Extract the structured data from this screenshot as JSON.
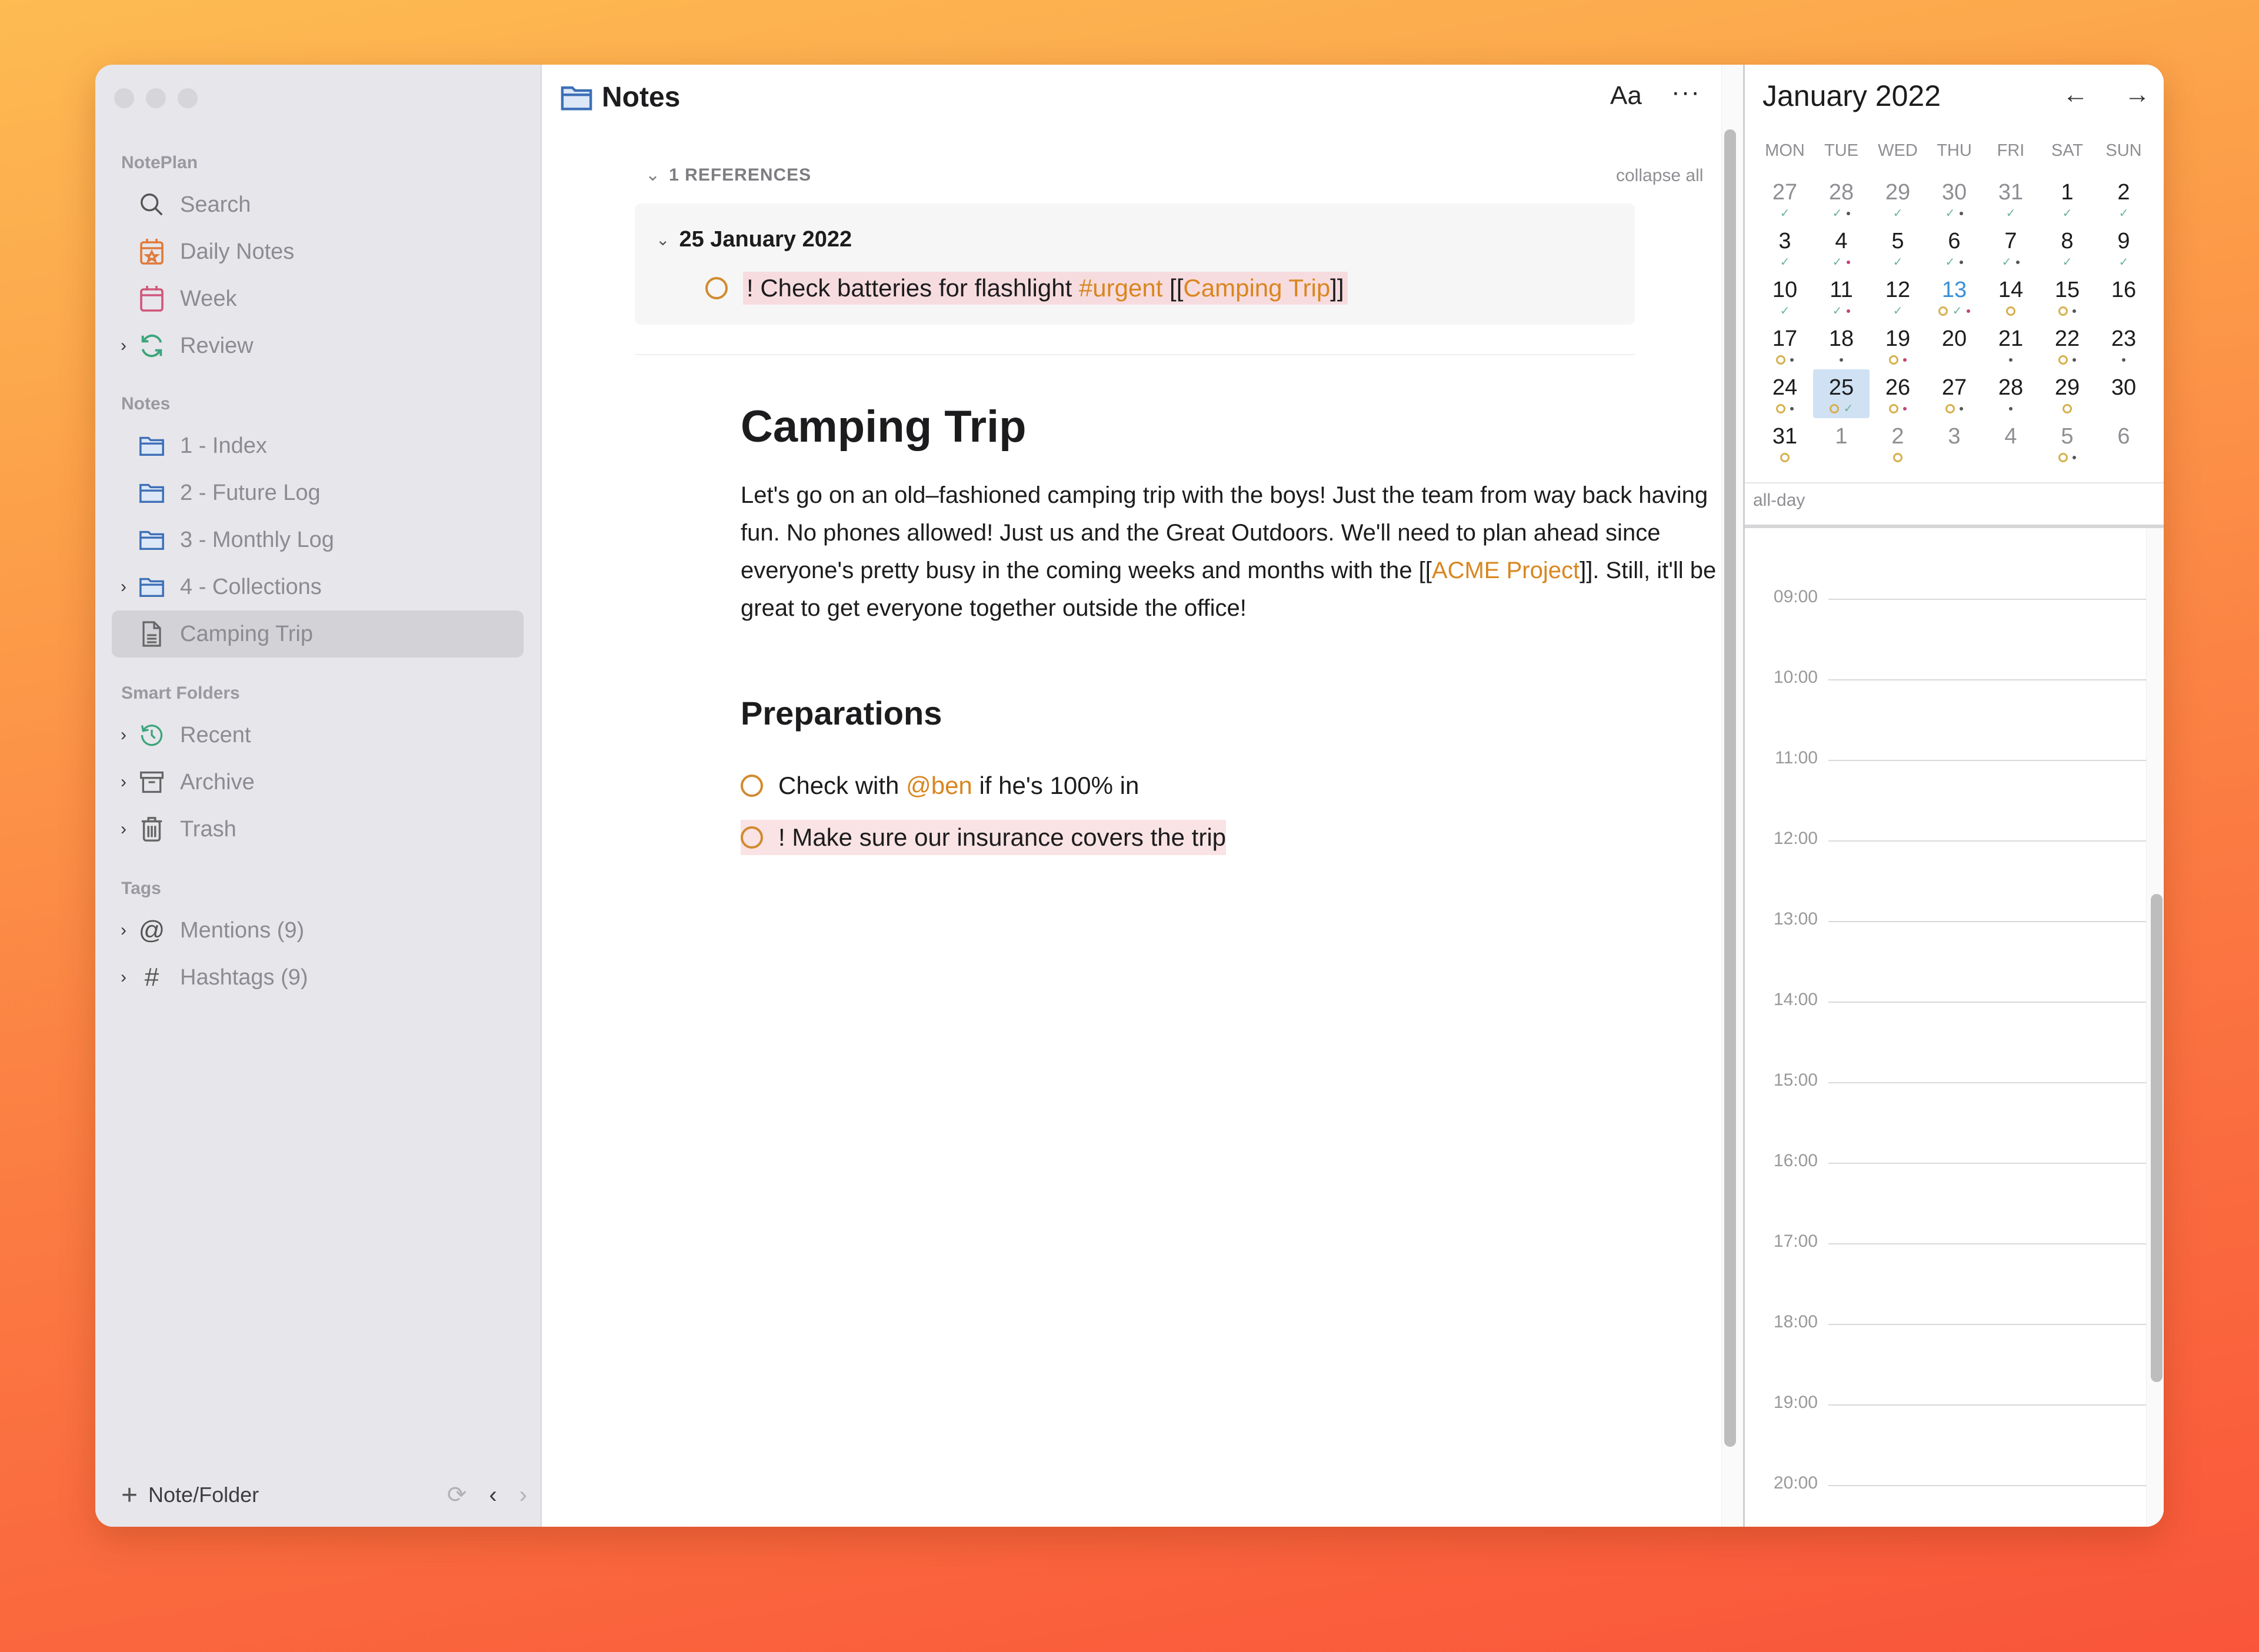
{
  "window": {
    "title": "Notes"
  },
  "sidebar": {
    "sections": [
      {
        "label": "NotePlan"
      },
      {
        "label": "Notes"
      },
      {
        "label": "Smart Folders"
      },
      {
        "label": "Tags"
      }
    ],
    "items": [
      {
        "label": "Search",
        "icon": "search-icon",
        "chevron": false
      },
      {
        "label": "Daily Notes",
        "icon": "daily-calendar-icon",
        "chevron": false
      },
      {
        "label": "Week",
        "icon": "week-calendar-icon",
        "chevron": false
      },
      {
        "label": "Review",
        "icon": "refresh-icon",
        "chevron": true
      },
      {
        "label": "1 - Index",
        "icon": "folder-icon",
        "chevron": false
      },
      {
        "label": "2 - Future Log",
        "icon": "folder-icon",
        "chevron": false
      },
      {
        "label": "3 - Monthly Log",
        "icon": "folder-icon",
        "chevron": false
      },
      {
        "label": "4 - Collections",
        "icon": "folder-icon",
        "chevron": true
      },
      {
        "label": "Camping Trip",
        "icon": "document-icon",
        "chevron": false,
        "selected": true
      },
      {
        "label": "Recent",
        "icon": "history-icon",
        "chevron": true
      },
      {
        "label": "Archive",
        "icon": "archive-icon",
        "chevron": true
      },
      {
        "label": "Trash",
        "icon": "trash-icon",
        "chevron": true
      },
      {
        "label": "Mentions (9)",
        "icon": "at-icon",
        "chevron": true
      },
      {
        "label": "Hashtags (9)",
        "icon": "hashtag-icon",
        "chevron": true
      }
    ],
    "footer": {
      "new_label": "Note/Folder"
    }
  },
  "editor": {
    "header_title": "Notes",
    "font_button": "Aa",
    "more_button": "···",
    "references": {
      "count_label": "1 REFERENCES",
      "collapse_all": "collapse all",
      "groups": [
        {
          "date": "25 January 2022",
          "task": {
            "prefix": "! Check batteries for flashlight ",
            "tag": "#urgent",
            "link_open": " [[",
            "link": "Camping Trip",
            "link_close": "]]"
          }
        }
      ]
    },
    "note": {
      "title": "Camping Trip",
      "paragraph": {
        "part1": "Let's go on an old–fashioned camping trip with the boys! Just the team from way back having fun. No phones allowed! Just us and the Great Outdoors. We'll need to plan ahead since everyone's pretty busy in the coming weeks and months with the [[",
        "link": "ACME Project",
        "part2": "]]. Still, it'll be great to get everyone together outside the office!"
      },
      "section_heading": "Preparations",
      "tasks": [
        {
          "before": "Check with ",
          "mention": "@ben",
          "after": " if he's 100% in",
          "urgent": false
        },
        {
          "before": "! Make sure our insurance covers the trip",
          "mention": "",
          "after": "",
          "urgent": true
        }
      ]
    }
  },
  "calendar": {
    "month_label": "January 2022",
    "prev": "←",
    "next": "→",
    "weekdays": [
      "MON",
      "TUE",
      "WED",
      "THU",
      "FRI",
      "SAT",
      "SUN"
    ],
    "weeks": [
      [
        {
          "d": "27",
          "other": true,
          "ind": [
            "done"
          ]
        },
        {
          "d": "28",
          "other": true,
          "ind": [
            "done",
            "dot"
          ]
        },
        {
          "d": "29",
          "other": true,
          "ind": [
            "done"
          ]
        },
        {
          "d": "30",
          "other": true,
          "ind": [
            "done",
            "dot"
          ]
        },
        {
          "d": "31",
          "other": true,
          "ind": [
            "done"
          ]
        },
        {
          "d": "1",
          "ind": [
            "done"
          ]
        },
        {
          "d": "2",
          "ind": [
            "done"
          ]
        }
      ],
      [
        {
          "d": "3",
          "ind": [
            "done"
          ]
        },
        {
          "d": "4",
          "ind": [
            "done",
            "pink"
          ]
        },
        {
          "d": "5",
          "ind": [
            "done"
          ]
        },
        {
          "d": "6",
          "ind": [
            "done",
            "dot"
          ]
        },
        {
          "d": "7",
          "ind": [
            "done",
            "dot"
          ]
        },
        {
          "d": "8",
          "ind": [
            "done"
          ]
        },
        {
          "d": "9",
          "ind": [
            "done"
          ]
        }
      ],
      [
        {
          "d": "10",
          "ind": [
            "done"
          ]
        },
        {
          "d": "11",
          "ind": [
            "done",
            "pink"
          ]
        },
        {
          "d": "12",
          "ind": [
            "done"
          ]
        },
        {
          "d": "13",
          "today": true,
          "ind": [
            "open",
            "done",
            "pink"
          ]
        },
        {
          "d": "14",
          "ind": [
            "open"
          ]
        },
        {
          "d": "15",
          "ind": [
            "open",
            "dot"
          ]
        },
        {
          "d": "16",
          "ind": []
        }
      ],
      [
        {
          "d": "17",
          "ind": [
            "open",
            "dot"
          ]
        },
        {
          "d": "18",
          "ind": [
            "dot"
          ]
        },
        {
          "d": "19",
          "ind": [
            "open",
            "pink"
          ]
        },
        {
          "d": "20",
          "ind": []
        },
        {
          "d": "21",
          "ind": [
            "dot"
          ]
        },
        {
          "d": "22",
          "ind": [
            "open",
            "dot"
          ]
        },
        {
          "d": "23",
          "ind": [
            "dot"
          ]
        }
      ],
      [
        {
          "d": "24",
          "ind": [
            "open",
            "dot"
          ]
        },
        {
          "d": "25",
          "selected": true,
          "ind": [
            "open",
            "done"
          ]
        },
        {
          "d": "26",
          "ind": [
            "open",
            "pink"
          ]
        },
        {
          "d": "27",
          "ind": [
            "open",
            "dot"
          ]
        },
        {
          "d": "28",
          "ind": [
            "dot"
          ]
        },
        {
          "d": "29",
          "ind": [
            "open"
          ]
        },
        {
          "d": "30",
          "ind": []
        }
      ],
      [
        {
          "d": "31",
          "ind": [
            "open"
          ]
        },
        {
          "d": "1",
          "other": true,
          "ind": []
        },
        {
          "d": "2",
          "other": true,
          "ind": [
            "open"
          ]
        },
        {
          "d": "3",
          "other": true,
          "ind": []
        },
        {
          "d": "4",
          "other": true,
          "ind": []
        },
        {
          "d": "5",
          "other": true,
          "ind": [
            "open",
            "dot"
          ]
        },
        {
          "d": "6",
          "other": true,
          "ind": []
        }
      ]
    ],
    "all_day_label": "all-day",
    "hours": [
      "09:00",
      "10:00",
      "11:00",
      "12:00",
      "13:00",
      "14:00",
      "15:00",
      "16:00",
      "17:00",
      "18:00",
      "19:00",
      "20:00"
    ]
  },
  "colors": {
    "accent_orange": "#d9861f",
    "urgent_highlight": "#f7dcdf",
    "selected_day": "#cfe1f3",
    "today_blue": "#3a8fd6",
    "folder_blue": "#3d6fb6"
  }
}
